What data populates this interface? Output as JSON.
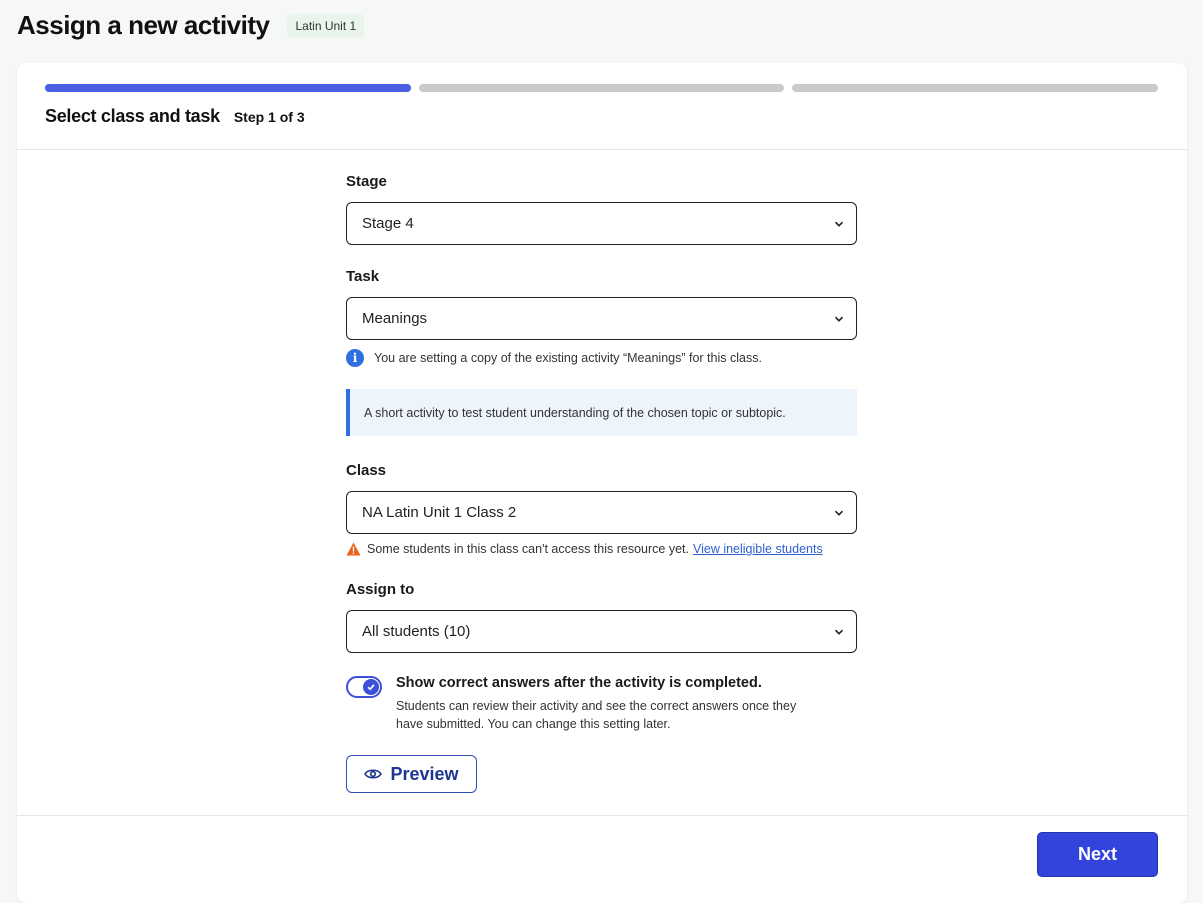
{
  "header": {
    "title": "Assign a new activity",
    "badge": "Latin Unit 1"
  },
  "wizard": {
    "progress": {
      "total_steps": 3,
      "current_step": 1
    },
    "step_title": "Select class and task",
    "step_count": "Step 1 of 3"
  },
  "form": {
    "stage": {
      "label": "Stage",
      "value": "Stage 4"
    },
    "task": {
      "label": "Task",
      "value": "Meanings",
      "info": "You are setting a copy of the existing activity “Meanings” for this class.",
      "description": "A short activity to test student understanding of the chosen topic or subtopic."
    },
    "class": {
      "label": "Class",
      "value": "NA Latin Unit 1 Class 2",
      "warning": "Some students in this class can't access this resource yet.",
      "warning_link": "View ineligible students"
    },
    "assign_to": {
      "label": "Assign to",
      "value": "All students (10)"
    },
    "show_answers": {
      "enabled": true,
      "title": "Show correct answers after the activity is completed.",
      "description": "Students can review their activity and see the correct answers once they have submitted. You can change this setting later."
    },
    "preview_label": "Preview"
  },
  "footer": {
    "next_label": "Next"
  },
  "colors": {
    "accent": "#4a5de3",
    "primary_button": "#3344dd",
    "info": "#2f6fe0",
    "warning": "#e8621c"
  },
  "icons": [
    "chevron-down-icon",
    "info-icon",
    "warning-icon",
    "check-icon",
    "eye-icon"
  ]
}
